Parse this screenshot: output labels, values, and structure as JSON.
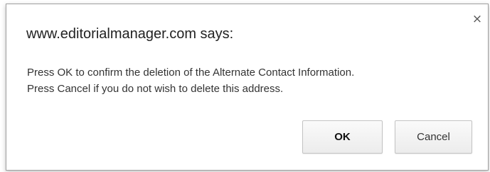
{
  "dialog": {
    "title": "www.editorialmanager.com says:",
    "close_icon": "close-icon",
    "close_glyph": "×",
    "message_line_1": "Press OK to confirm the deletion of the Alternate Contact Information.",
    "message_line_2": "Press Cancel if you do not wish to delete this address.",
    "ok_label": "OK",
    "cancel_label": "Cancel"
  }
}
